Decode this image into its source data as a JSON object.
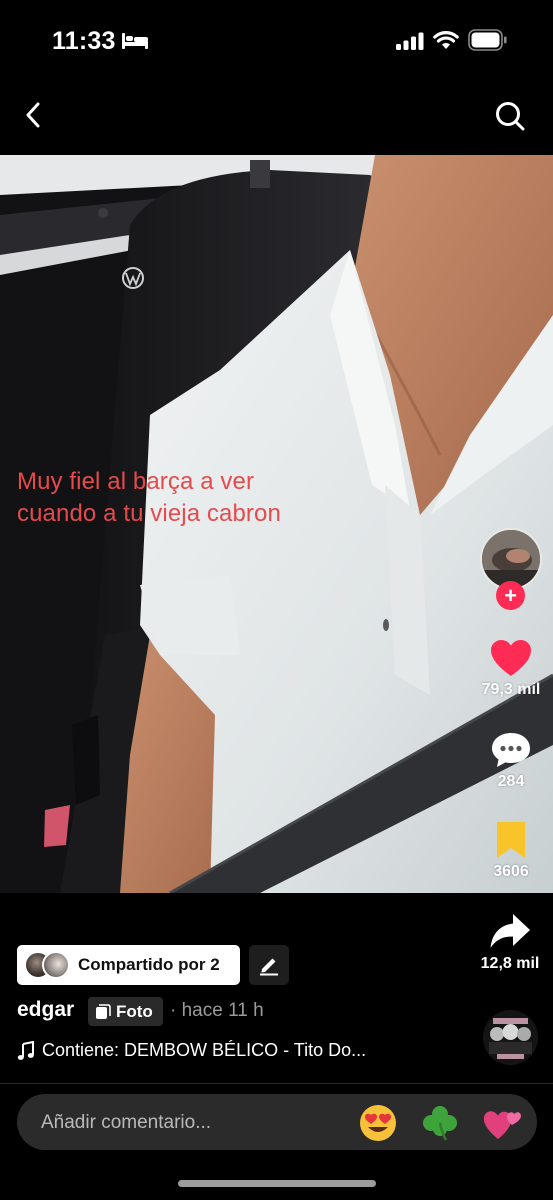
{
  "status_bar": {
    "time": "11:33",
    "icons": [
      "bed-icon",
      "signal-icon",
      "wifi-icon",
      "battery-icon"
    ]
  },
  "nav": {
    "back_icon": "chevron-left-icon",
    "search_icon": "search-icon"
  },
  "post": {
    "caption_lines": [
      "Muy fiel al barça a ver",
      "cuando a tu vieja cabron"
    ],
    "caption_color": "#e64a4d",
    "likes": "79,3 mil",
    "comments": "284",
    "saves": "3606",
    "shares": "12,8 mil"
  },
  "bottom": {
    "shared_label": "Compartido por 2",
    "username": "edgar",
    "photo_badge": "Foto",
    "time_ago": "· hace 11 h",
    "music": "Contiene: DEMBOW BÉLICO - Tito Do..."
  },
  "comment_bar": {
    "placeholder": "Añadir comentario...",
    "emojis": [
      "😍",
      "🍀",
      "💞"
    ]
  },
  "colors": {
    "like": "#fe2c55",
    "save": "#f8c42a",
    "follow": "#fe2c55"
  }
}
